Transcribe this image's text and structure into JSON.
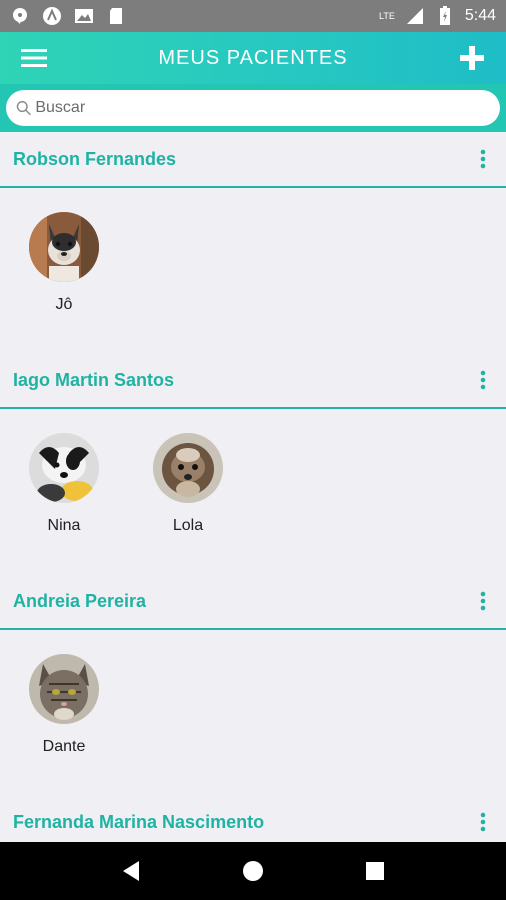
{
  "status_bar": {
    "time": "5:44",
    "network": "LTE"
  },
  "app_bar": {
    "title": "MEUS PACIENTES"
  },
  "search": {
    "placeholder": "Buscar"
  },
  "owners": [
    {
      "name": "Robson Fernandes",
      "pets": [
        {
          "name": "Jô"
        }
      ]
    },
    {
      "name": "Iago Martin Santos",
      "pets": [
        {
          "name": "Nina"
        },
        {
          "name": "Lola"
        }
      ]
    },
    {
      "name": "Andreia Pereira",
      "pets": [
        {
          "name": "Dante"
        }
      ]
    },
    {
      "name": "Fernanda Marina Nascimento",
      "pets": []
    }
  ],
  "colors": {
    "accent": "#1fb3a3",
    "app_bar": "#26c7c2",
    "background": "#efeff4"
  }
}
